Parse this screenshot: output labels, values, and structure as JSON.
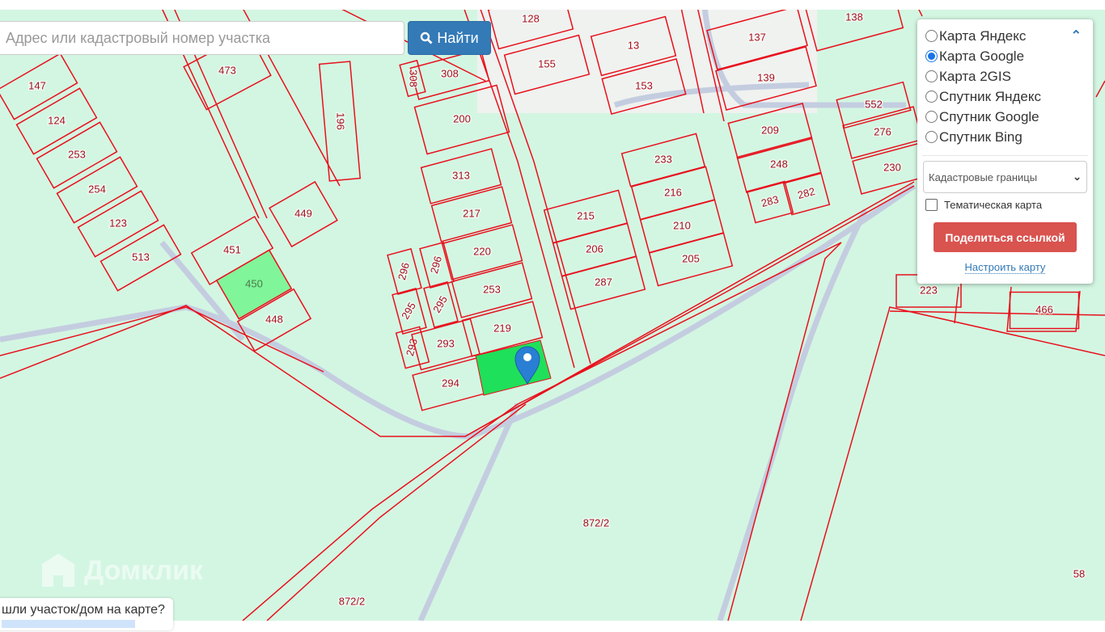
{
  "search": {
    "placeholder": "Адрес или кадастровый номер участка",
    "button_label": "Найти",
    "button_icon": "search-icon"
  },
  "layer_panel": {
    "options": [
      {
        "label": "Карта Яндекс",
        "selected": false
      },
      {
        "label": "Карта Google",
        "selected": true
      },
      {
        "label": "Карта 2GIS",
        "selected": false
      },
      {
        "label": "Спутник Яндекс",
        "selected": false
      },
      {
        "label": "Спутник Google",
        "selected": false
      },
      {
        "label": "Спутник Bing",
        "selected": false
      }
    ],
    "layer_select": "Кадастровые границы",
    "thematic_label": "Тематическая карта",
    "thematic_checked": false,
    "share_button": "Поделиться ссылкой",
    "settings_link": "Настроить карту"
  },
  "map": {
    "parcel_labels": [
      "128",
      "155",
      "13",
      "153",
      "138",
      "137",
      "139",
      "473",
      "147",
      "124",
      "253",
      "254",
      "123",
      "513",
      "196",
      "308",
      "308",
      "200",
      "313",
      "217",
      "220",
      "253",
      "219",
      "296",
      "296",
      "295",
      "295",
      "293",
      "293",
      "294",
      "449",
      "451",
      "450",
      "448",
      "215",
      "206",
      "287",
      "233",
      "216",
      "210",
      "205",
      "209",
      "248",
      "283",
      "282",
      "552",
      "276",
      "230",
      "223",
      "466",
      "872/2",
      "872/2",
      "58"
    ],
    "selected_parcel_color": "#1fe05a",
    "highlight_parcel_color": "#80f59a",
    "boundary_color": "#e8101c"
  },
  "watermark": "Домклик",
  "question_banner": "шли участок/дом на карте?"
}
